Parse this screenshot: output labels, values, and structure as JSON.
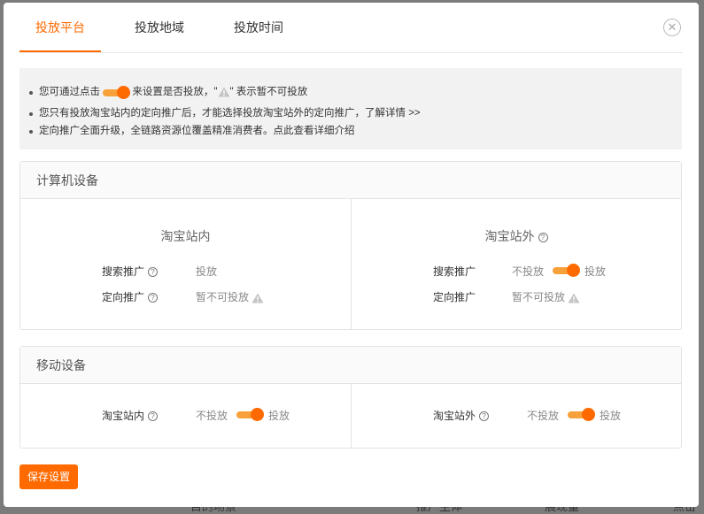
{
  "background": {
    "text_left": "",
    "bottom_labels": [
      "目的场景",
      "推广主体",
      "展现量",
      "点击量"
    ]
  },
  "tabs": [
    {
      "label": "投放平台",
      "active": true
    },
    {
      "label": "投放地域",
      "active": false
    },
    {
      "label": "投放时间",
      "active": false
    }
  ],
  "close_label": "✕",
  "notice": {
    "line1_before": "您可通过点击",
    "line1_middle": "来设置是否投放，\"",
    "line1_after": "\" 表示暂不可投放",
    "line2": "您只有投放淘宝站内的定向推广后，才能选择投放淘宝站外的定向推广，",
    "line2_link": "了解详情 >>",
    "line3": "定向推广全面升级，全链路资源位覆盖精准消费者。点此查看详细介绍"
  },
  "computer": {
    "title": "计算机设备",
    "inside": {
      "title": "淘宝站内",
      "rows": [
        {
          "label": "搜索推广",
          "value": "投放"
        },
        {
          "label": "定向推广",
          "value": "暂不可投放"
        }
      ]
    },
    "outside": {
      "title": "淘宝站外",
      "rows": [
        {
          "label": "搜索推广",
          "off": "不投放",
          "on": "投放"
        },
        {
          "label": "定向推广",
          "value": "暂不可投放"
        }
      ]
    }
  },
  "mobile": {
    "title": "移动设备",
    "inside": {
      "label": "淘宝站内",
      "off": "不投放",
      "on": "投放"
    },
    "outside": {
      "label": "淘宝站外",
      "off": "不投放",
      "on": "投放"
    }
  },
  "help_glyph": "?",
  "save_label": "保存设置",
  "colors": {
    "accent": "#ff6a00",
    "switch_track": "#f7a13b"
  }
}
